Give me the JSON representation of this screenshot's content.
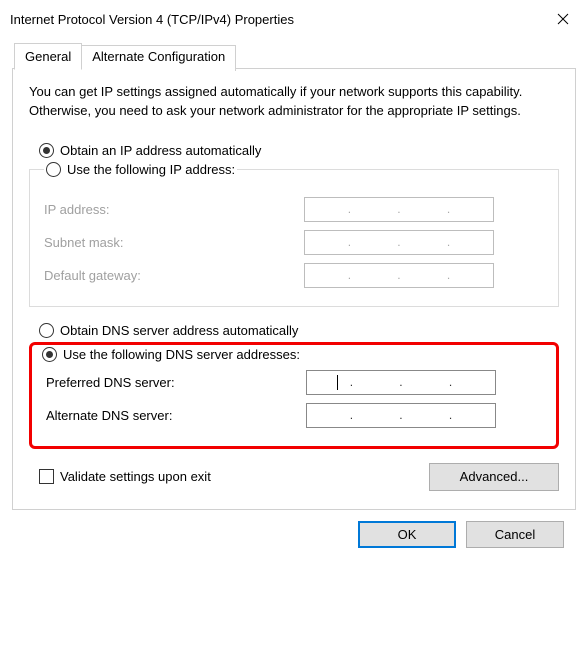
{
  "window": {
    "title": "Internet Protocol Version 4 (TCP/IPv4) Properties"
  },
  "tabs": {
    "general": "General",
    "alternate": "Alternate Configuration"
  },
  "intro": "You can get IP settings assigned automatically if your network supports this capability. Otherwise, you need to ask your network administrator for the appropriate IP settings.",
  "ip": {
    "auto_label": "Obtain an IP address automatically",
    "manual_label": "Use the following IP address:",
    "auto_selected": true,
    "ip_address_label": "IP address:",
    "subnet_label": "Subnet mask:",
    "gateway_label": "Default gateway:",
    "ip_address": "",
    "subnet": "",
    "gateway": ""
  },
  "dns": {
    "auto_label": "Obtain DNS server address automatically",
    "manual_label": "Use the following DNS server addresses:",
    "manual_selected": true,
    "preferred_label": "Preferred DNS server:",
    "alternate_label": "Alternate DNS server:",
    "preferred": "",
    "alternate": ""
  },
  "validate_label": "Validate settings upon exit",
  "validate_checked": false,
  "advanced_label": "Advanced...",
  "ok_label": "OK",
  "cancel_label": "Cancel"
}
